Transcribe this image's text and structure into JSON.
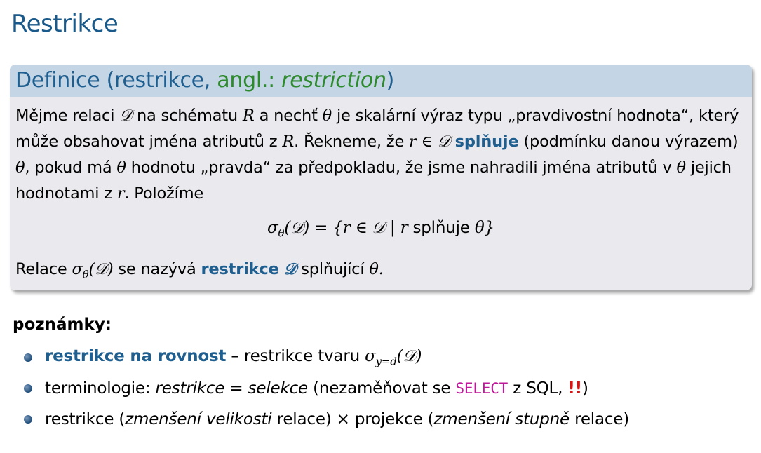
{
  "slide": {
    "title": "Restrikce"
  },
  "definition": {
    "head_prefix": "Definice (restrikce, ",
    "head_angl": "angl.: ",
    "head_term": "restriction",
    "head_suffix": ")",
    "p1": "Mějme relaci ",
    "p2": " na schématu ",
    "p3": " a nechť ",
    "p4": " je skalární výraz typu „pravdivostní hodnota“, který může obsahovat jména atributů z ",
    "p5": ". Řekneme, že ",
    "p6_bold": "splňuje",
    "p7": " (podmínku danou výrazem) ",
    "p8": ", pokud má ",
    "p9": " hodnotu „pravda“ za předpokladu, že jsme nahradili jména atributů v ",
    "p10": " jejich hodnotami z ",
    "p11": ". Položíme",
    "formula_mid": " splňuje ",
    "final_prefix": "Relace ",
    "final_mid": " se nazývá ",
    "final_bold": "restrikce",
    "final_suffix": " splňující "
  },
  "notes": {
    "heading": "poznámky:",
    "item1_bold": "restrikce na rovnost",
    "item1_text": " – restrikce tvaru ",
    "item2_text": "terminologie: ",
    "item2_it1": "restrikce",
    "item2_eq": " = ",
    "item2_it2": "selekce",
    "item2_paren": " (nezaměňovat se ",
    "item2_code": "SELECT",
    "item2_sql": " z SQL, ",
    "item2_alert": "!!",
    "item2_close": ")",
    "item3_a": "restrikce (",
    "item3_it1": "zmenšení velikosti",
    "item3_b": " relace) × projekce (",
    "item3_it2": "zmenšení stupně",
    "item3_c": " relace)"
  }
}
